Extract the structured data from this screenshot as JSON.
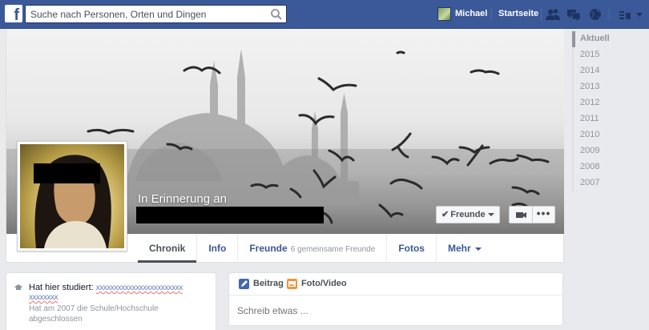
{
  "topbar": {
    "logo": "f",
    "search_placeholder": "Suche nach Personen, Orten und Dingen",
    "user_name": "Michael",
    "home_label": "Startseite"
  },
  "profile": {
    "memorial_label": "In Erinnerung an",
    "friends_button": "Freunde",
    "more_button": "•••"
  },
  "tabs": {
    "chronik": "Chronik",
    "info": "Info",
    "freunde": "Freunde",
    "freunde_sub": "6 gemeinsame Freunde",
    "fotos": "Fotos",
    "mehr": "Mehr"
  },
  "timeline_years": [
    "Aktuell",
    "2015",
    "2014",
    "2013",
    "2012",
    "2011",
    "2010",
    "2009",
    "2008",
    "2007"
  ],
  "intro": {
    "studied_label": "Hat hier studiert:",
    "school_line1": "xxxxxxxxxxxxxxxxxxxxxxxx",
    "school_line2": "xxxxxxxx",
    "graduated": "Hat am 2007 die Schule/Hochschule abgeschlossen"
  },
  "composer": {
    "post_tab": "Beitrag",
    "photo_tab": "Foto/Video",
    "placeholder": "Schreib etwas ..."
  },
  "colors": {
    "brand_blue": "#3b5998",
    "link_blue": "#3b5998",
    "muted": "#90949c",
    "page_bg": "#e9eaed"
  }
}
